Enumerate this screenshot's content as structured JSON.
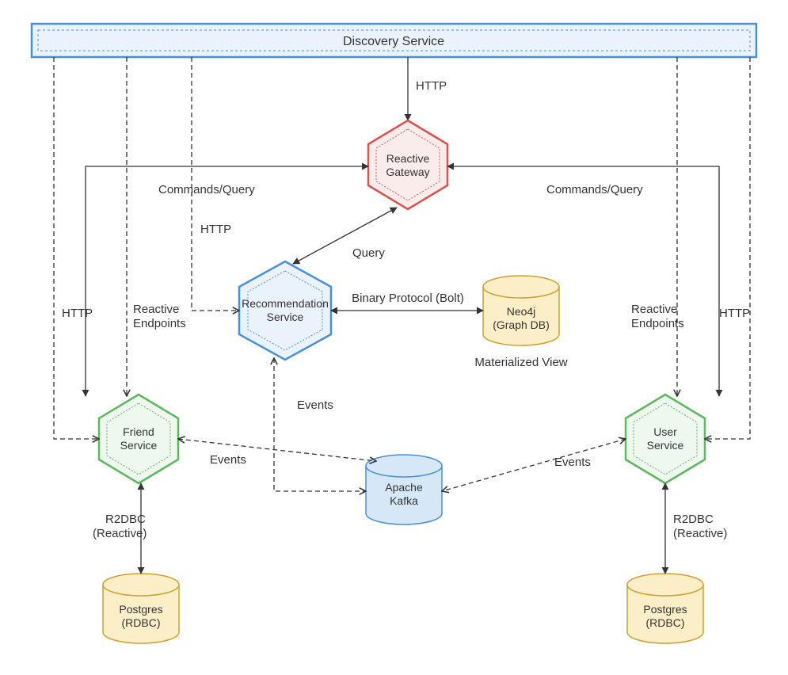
{
  "colors": {
    "red_stroke": "#d9534f",
    "red_fill": "#f9eceb",
    "blue_stroke": "#4a90d9",
    "blue_fill": "#eaf2fb",
    "green_stroke": "#5cb85c",
    "green_fill": "#eef8ee",
    "yellow_stroke": "#d0a030",
    "yellow_fill": "#fceec7",
    "cyl_blue_stroke": "#4a90d9",
    "cyl_blue_fill": "#d6e8f8",
    "discovery_stroke": "#4a90d9",
    "discovery_fill": "#eaf2fb",
    "line": "#333333"
  },
  "nodes": {
    "discovery": {
      "label": "Discovery Service"
    },
    "reactive_gateway": {
      "label1": "Reactive",
      "label2": "Gateway"
    },
    "recommendation": {
      "label1": "Recommendation",
      "label2": "Service"
    },
    "friend": {
      "label1": "Friend",
      "label2": "Service"
    },
    "user": {
      "label1": "User",
      "label2": "Service"
    },
    "neo4j": {
      "label1": "Neo4j",
      "label2": "(Graph DB)",
      "caption": "Materialized View"
    },
    "kafka": {
      "label1": "Apache",
      "label2": "Kafka"
    },
    "postgres_left": {
      "label1": "Postgres",
      "label2": "(RDBC)"
    },
    "postgres_right": {
      "label1": "Postgres",
      "label2": "(RDBC)"
    }
  },
  "edges": {
    "discovery_gateway": "HTTP",
    "discovery_friend_http": "HTTP",
    "discovery_friend_reactive1": "Reactive",
    "discovery_friend_reactive2": "Endpoints",
    "discovery_rec": "HTTP",
    "discovery_user_http": "HTTP",
    "discovery_user_reactive1": "Reactive",
    "discovery_user_reactive2": "Endpoints",
    "gateway_friend": "Commands/Query",
    "gateway_user": "Commands/Query",
    "gateway_rec": "Query",
    "rec_neo4j": "Binary Protocol (Bolt)",
    "rec_kafka": "Events",
    "friend_kafka": "Events",
    "user_kafka": "Events",
    "friend_postgres1": "R2DBC",
    "friend_postgres2": "(Reactive)",
    "user_postgres1": "R2DBC",
    "user_postgres2": "(Reactive)"
  }
}
